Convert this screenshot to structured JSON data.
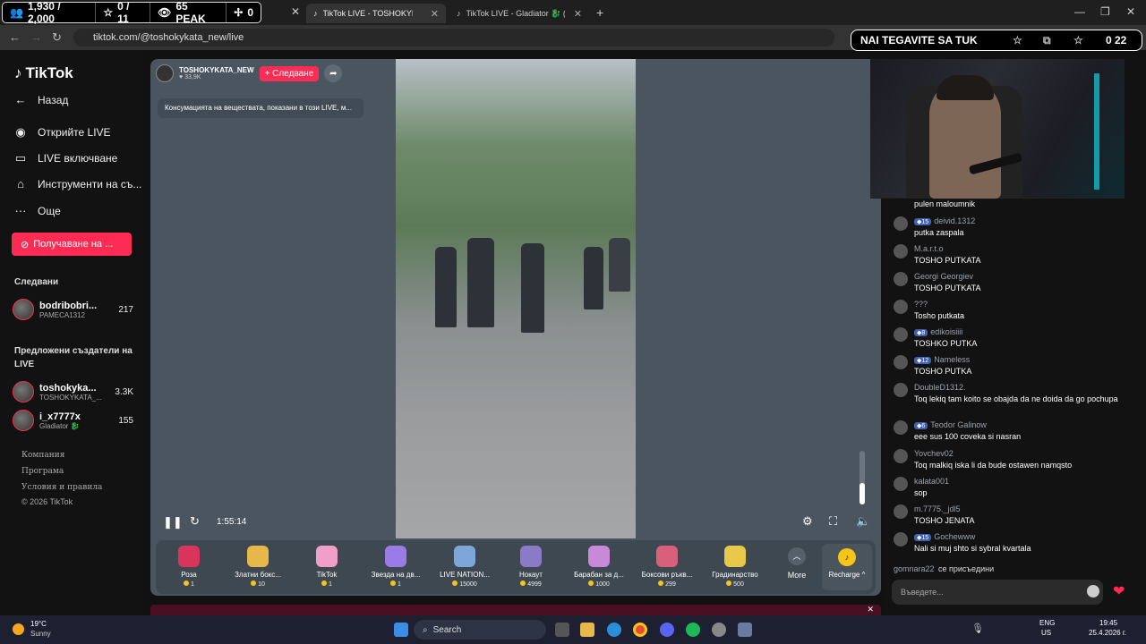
{
  "stream_stats": {
    "viewers": "1,930 / 2,000",
    "stars": "0 / 11",
    "peak": "65 PEAK",
    "extra": "0"
  },
  "tabs": [
    {
      "title": "TikTok LIVE - TOSHOKYKATA",
      "active": true
    },
    {
      "title": "TikTok LIVE - Gladiator 🐉 (@...",
      "active": false
    }
  ],
  "address_bar": {
    "url": "tiktok.com/@toshokykata_new/live"
  },
  "overlay_banner": {
    "text": "NAI TEGAVITE SA TUK",
    "counter": "0 22"
  },
  "sidebar": {
    "logo": "TikTok",
    "back": "Назад",
    "nav": [
      {
        "label": "Открийте LIVE",
        "icon": "live-discover-icon"
      },
      {
        "label": "LIVE включване",
        "icon": "camera-icon"
      },
      {
        "label": "Инструменти на съ...",
        "icon": "tools-icon"
      },
      {
        "label": "Още",
        "icon": "more-dots-icon"
      }
    ],
    "cta": "Получаване на ...",
    "following_heading": "Следвани",
    "following": [
      {
        "name": "bodribobri...",
        "sub": "PAMECA1312",
        "count": "217"
      }
    ],
    "suggested_heading": "Предложени създатели на LIVE",
    "suggested": [
      {
        "name": "toshokyka...",
        "sub": "TOSHOKYKATA_...",
        "count": "3.3K"
      },
      {
        "name": "i_x7777x",
        "sub": "Gladiator 🐉",
        "count": "155"
      }
    ],
    "footer": [
      "Компания",
      "Програма",
      "Условия и правила",
      "© 2026 TikTok"
    ]
  },
  "player": {
    "host_name": "TOSHOKYKATA_NEW",
    "host_likes": "♥ 33,9K",
    "follow_label": "+ Следване",
    "notice": "Консумацията на веществата, показани в този LIVE, м...",
    "time": "1:55:14",
    "volume_level": 0.4,
    "gifts": [
      {
        "name": "Роза",
        "price": "1",
        "color": "#d9345c"
      },
      {
        "name": "Златни бокс...",
        "price": "10",
        "color": "#e8b74a"
      },
      {
        "name": "TikTok",
        "price": "1",
        "color": "#f0a0c8"
      },
      {
        "name": "Звезда на дв...",
        "price": "1",
        "color": "#9a7be8"
      },
      {
        "name": "LIVE NATION...",
        "price": "15000",
        "color": "#7fa6d8"
      },
      {
        "name": "Нокаут",
        "price": "4999",
        "color": "#8a7ac8"
      },
      {
        "name": "Барабан за д...",
        "price": "1000",
        "color": "#c88ad8"
      },
      {
        "name": "Боксови ръкв...",
        "price": "299",
        "color": "#d8607a"
      },
      {
        "name": "Градинарство",
        "price": "500",
        "color": "#e8c84a"
      }
    ],
    "more_label": "More",
    "recharge_label": "Recharge ^"
  },
  "chat": {
    "messages": [
      {
        "user": "",
        "badge": "",
        "text": "pulen maloumnik"
      },
      {
        "user": "deivid.1312",
        "badge": "15",
        "text": "putka zaspala"
      },
      {
        "user": "M.a.r.t.o",
        "badge": "",
        "text": "TOSHO PUTKATA"
      },
      {
        "user": "Georgi Georgiev",
        "badge": "",
        "text": "TOSHO PUTKATA"
      },
      {
        "user": "???",
        "badge": "",
        "text": "Tosho putkata"
      },
      {
        "user": "edikoisiiii",
        "badge": "8",
        "text": "TOSHKO PUTKA"
      },
      {
        "user": "Nameless",
        "badge": "12",
        "text": "TOSHO PUTKA"
      },
      {
        "user": "DoubleD1312.",
        "badge": "",
        "text": "Toq lekiq tam koito se obajda da ne doida da go pochupa"
      },
      {
        "user": "Teodor Galinow",
        "badge": "6",
        "text": "eee sus 100 coveka si nasran"
      },
      {
        "user": "Yovchev02",
        "badge": "",
        "text": "Toq malkiq iska li da bude ostawen namqsto"
      },
      {
        "user": "kalata001",
        "badge": "",
        "text": "sop"
      },
      {
        "user": "m.7775._jdl5",
        "badge": "",
        "text": "TOSHO JENATA"
      },
      {
        "user": "Gochewww",
        "badge": "15",
        "text": "Nali si muj shto si sybral kvartala"
      }
    ],
    "join_user": "gomnara22",
    "join_text": "се присъедини",
    "input_placeholder": "Въведете..."
  },
  "taskbar": {
    "weather_temp": "19°C",
    "weather_desc": "Sunny",
    "search": "Search",
    "lang": "ENG",
    "region": "US",
    "time": "19:45",
    "date": "25.4.2026 г."
  }
}
